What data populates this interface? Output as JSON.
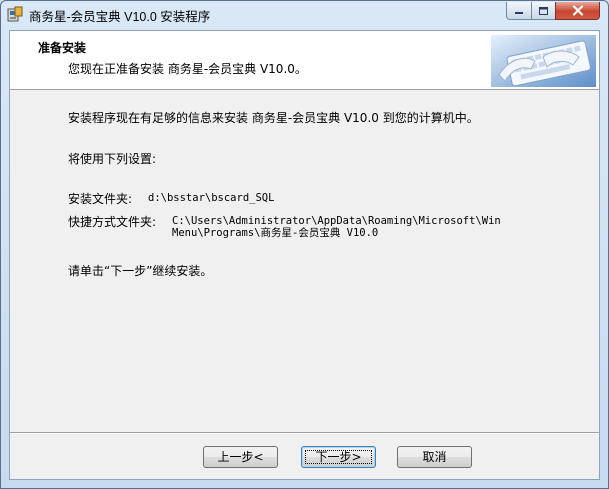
{
  "window": {
    "title": "商务星-会员宝典 V10.0 安装程序",
    "icon": "installer-app-icon"
  },
  "title_controls": {
    "minimize": "minimize-icon",
    "maximize": "maximize-icon",
    "close": "close-icon"
  },
  "header": {
    "title": "准备安装",
    "subtitle": "您现在正准备安装 商务星-会员宝典 V10.0。",
    "image": "keyboard-hands-image"
  },
  "body": {
    "intro": "安装程序现在有足够的信息来安装 商务星-会员宝典 V10.0 到您的计算机中。",
    "settings_heading": "将使用下列设置:",
    "install_folder_label": "安装文件夹:",
    "install_folder_value": "d:\\bsstar\\bscard_SQL",
    "shortcut_folder_label": "快捷方式文件夹:",
    "shortcut_folder_line1": "C:\\Users\\Administrator\\AppData\\Roaming\\Microsoft\\Win",
    "shortcut_folder_line2": "Menu\\Programs\\商务星-会员宝典 V10.0",
    "instruction": "请单击“下一步”继续安装。"
  },
  "buttons": {
    "back": "上一步<",
    "next": "下一步>",
    "cancel": "取消"
  }
}
